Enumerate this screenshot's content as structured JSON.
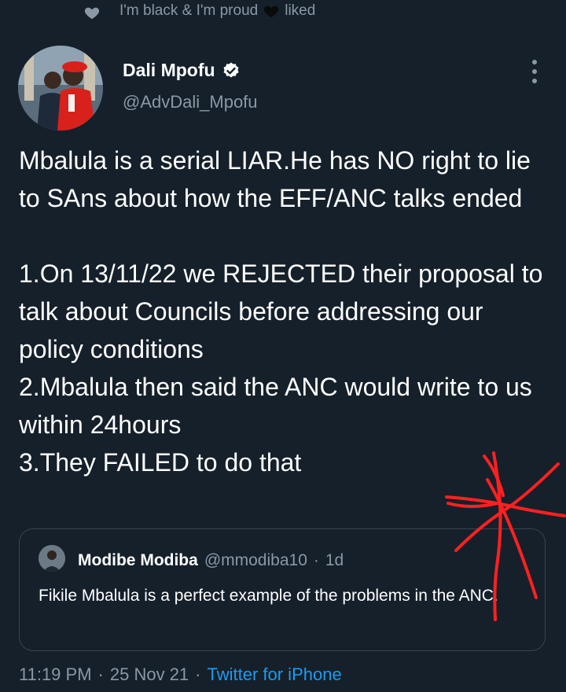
{
  "social_context": {
    "liker_name": "I'm black & I'm proud",
    "action": "liked"
  },
  "author": {
    "name": "Dali Mpofu",
    "handle": "@AdvDali_Mpofu"
  },
  "tweet": {
    "paragraph_1": "Mbalula is a serial LIAR.He has NO right to lie to SAns about how the EFF/ANC talks ended",
    "line_1": "1.On 13/11/22 we REJECTED their proposal to talk about Councils before addressing our policy conditions",
    "line_2": "2.Mbalula then said the ANC would write to us within 24hours",
    "line_3": "3.They FAILED to do that"
  },
  "quoted_tweet": {
    "name": "Modibe Modiba",
    "handle": "@mmodiba10",
    "separator": "·",
    "time": "1d",
    "text": "Fikile Mbalula is a perfect example of the problems in the ANC."
  },
  "meta": {
    "time": "11:19 PM",
    "separator_1": "·",
    "date": "25 Nov 21",
    "separator_2": "·",
    "source": "Twitter for iPhone"
  },
  "colors": {
    "background": "#15202b",
    "secondary_text": "#8b98a5",
    "link": "#1d9bf0",
    "annotation": "#ff2020"
  },
  "icons": {
    "like": "heart-icon",
    "verified": "verified-badge-icon",
    "more": "more-options-icon"
  }
}
